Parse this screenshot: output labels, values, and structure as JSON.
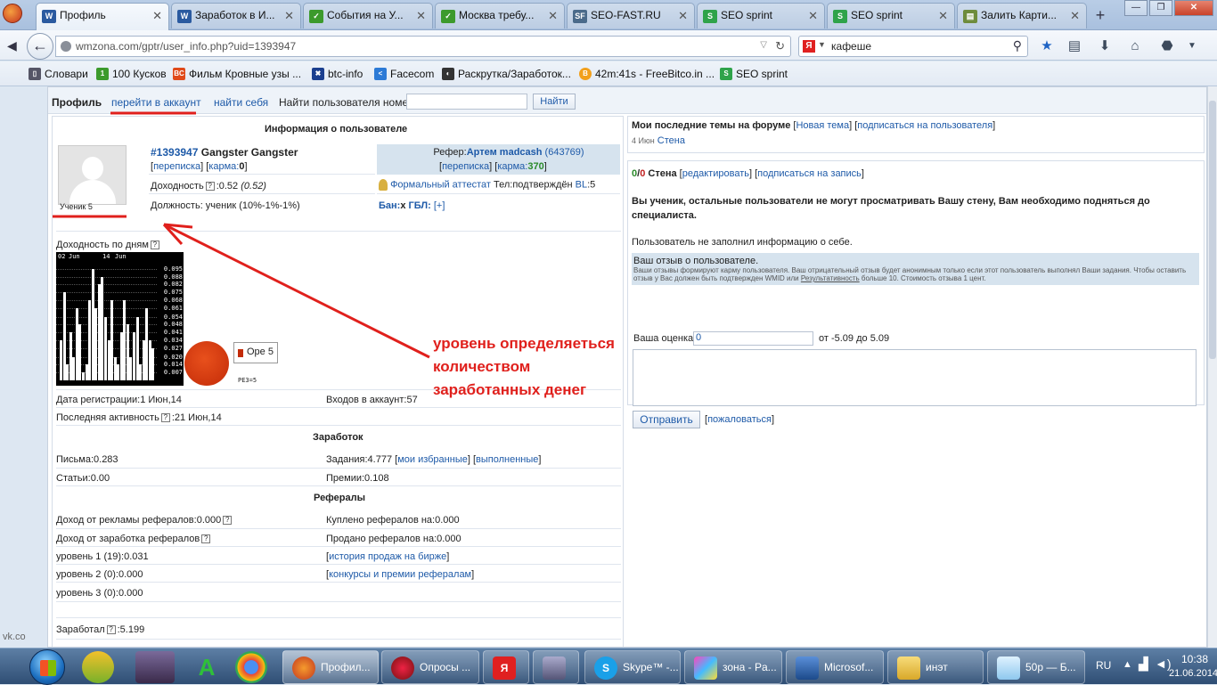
{
  "browser": {
    "tabs": [
      {
        "label": "Профиль",
        "icon": "wmzona-icon",
        "active": true
      },
      {
        "label": "Заработок в И...",
        "icon": "wmzona-icon"
      },
      {
        "label": "События на У...",
        "icon": "green-bookmark-icon"
      },
      {
        "label": "Москва требу...",
        "icon": "green-bookmark-icon"
      },
      {
        "label": "SEO-FAST.RU",
        "icon": "seofast-icon"
      },
      {
        "label": "SEO sprint",
        "icon": "seosprint-icon"
      },
      {
        "label": "SEO sprint",
        "icon": "seosprint-icon"
      },
      {
        "label": "Залить Карти...",
        "icon": "image-icon"
      }
    ],
    "url": "wmzona.com/gptr/user_info.php?uid=1393947",
    "search_value": "кафеше",
    "bookmarks": [
      {
        "label": "Словари",
        "icon": "dictionary-icon"
      },
      {
        "label": "100 Кусков",
        "icon": "green-bookmark-icon"
      },
      {
        "label": "Фильм Кровные узы ...",
        "icon": "bc-icon"
      },
      {
        "label": "btc-info",
        "icon": "btc-icon"
      },
      {
        "label": "Facecom",
        "icon": "facecom-icon"
      },
      {
        "label": "Раскрутка/Заработок...",
        "icon": "pacman-icon"
      },
      {
        "label": "42m:41s - FreeBitco.in ...",
        "icon": "bitcoin-icon"
      },
      {
        "label": "SEO sprint",
        "icon": "seosprint-icon"
      }
    ]
  },
  "site_menu": {
    "profile": "Профиль",
    "go_to_account": "перейти в аккаунт",
    "find_self": "найти себя",
    "find_user_label": "Найти пользователя номер",
    "find_button": "Найти"
  },
  "user_info": {
    "section_title": "Информация о пользователе",
    "user_id": "#1393947",
    "user_name": "Gangster Gangster",
    "correspondence": "переписка",
    "karma_label": "карма:",
    "karma_value": "0",
    "profitability_label": "Доходность",
    "profitability_value": ":0.52",
    "profitability_paren": "(0.52)",
    "position": "Должность: ученик (10%-1%-1%)",
    "avatar_caption": "Ученик 5",
    "referrer_label": "Рефер:",
    "referrer_name": "Артем madcash",
    "referrer_id": "(643769)",
    "referrer_correspondence": "переписка",
    "referrer_karma_label": "карма:",
    "referrer_karma_value": "370",
    "certificate": "Формальный аттестат",
    "phone": "Тел:подтверждён",
    "bl_label": "BL",
    "bl_value": ":5",
    "ban_label": "Бан:",
    "ban_value": "х",
    "gbl_label": "ГБЛ:",
    "gbl_value": "[+]",
    "daily_profit_label": "Доходность по дням",
    "pie_legend": "Ope 5",
    "pie_caption": "PE3=5",
    "reg_date": "Дата регистрации:1 Июн,14",
    "logins": "Входов в аккаунт:57",
    "last_activity_label": "Последняя активность",
    "last_activity_value": ":21 Июн,14"
  },
  "earnings": {
    "title": "Заработок",
    "letters": "Письма:0.283",
    "tasks": "Задания:4.777",
    "my_favorites": "мои избранные",
    "completed": "выполненные",
    "articles": "Статьи:0.00",
    "bonuses": "Премии:0.108"
  },
  "referrals": {
    "title": "Рефералы",
    "ads_income": "Доход от рекламы рефералов:0.000",
    "bought": "Куплено рефералов на:0.000",
    "earn_income": "Доход от заработка рефералов",
    "sold": "Продано рефералов на:0.000",
    "level1": "уровень 1 (19):0.031",
    "sales_history": "история продаж на бирже",
    "level2": "уровень 2 (0):0.000",
    "contests": "конкурсы и премии рефералам",
    "level3": "уровень 3 (0):0.000",
    "earned_label": "Заработал",
    "earned_value": ":5.199"
  },
  "forum": {
    "title": "Мои последние темы на форуме",
    "new_topic": "Новая тема",
    "subscribe_user": "подписаться на пользователя",
    "date": "4 Июн",
    "wall_link": "Стена"
  },
  "wall": {
    "count_a": "0",
    "count_sep": "/",
    "count_b": "0",
    "title": "Стена",
    "edit": "редактировать",
    "subscribe_post": "подписаться на запись",
    "notice": "Вы ученик, остальные пользователи не могут просматривать Вашу стену, Вам необходимо подняться до специалиста.",
    "no_info": "Пользователь не заполнил информацию о себе."
  },
  "review": {
    "title": "Ваш отзыв о пользователе.",
    "note_part1": "Ваши отзывы формируют карму пользователя. Ваш отрицательный отзыв будет анонимным только если этот пользователь выполнял Ваши задания. Чтобы оставить отзыв у Вас должен быть подтвержден WMID или ",
    "note_link": "Результативность",
    "note_part2": " больше 10. Стоимость отзыва 1 цент.",
    "rating_label": "Ваша оценка",
    "rating_value": "0",
    "range": "от -5.09 до 5.09",
    "send_button": "Отправить",
    "complain": "пожаловаться"
  },
  "annotation": {
    "line1": "уровень определяеться",
    "line2": "количеством",
    "line3": "заработанных денег",
    "color": "#e0201c"
  },
  "chart_data": {
    "type": "bar",
    "x_ticks": [
      "02",
      "Jun",
      "14",
      "Jun"
    ],
    "y_ticks": [
      "0.095",
      "0.088",
      "0.082",
      "0.075",
      "0.068",
      "0.061",
      "0.054",
      "0.048",
      "0.041",
      "0.034",
      "0.027",
      "0.020",
      "0.014",
      "0.007"
    ],
    "ylim": [
      0,
      0.1
    ],
    "values": [
      0.034,
      0.075,
      0.014,
      0.041,
      0.02,
      0.061,
      0.048,
      0.007,
      0.014,
      0.068,
      0.095,
      0.061,
      0.082,
      0.088,
      0.054,
      0.034,
      0.068,
      0.02,
      0.014,
      0.041,
      0.068,
      0.048,
      0.02,
      0.041,
      0.054,
      0.014,
      0.034,
      0.061,
      0.034,
      0.027
    ]
  },
  "taskbar": {
    "apps": [
      {
        "label": "Профил...",
        "icon": "firefox-icon",
        "active": true
      },
      {
        "label": "Опросы ...",
        "icon": "opera-like-icon"
      },
      {
        "label": "",
        "icon": "yandex-icon"
      },
      {
        "label": "",
        "icon": "sound-icon"
      },
      {
        "label": "Skype™ -...",
        "icon": "skype-icon"
      },
      {
        "label": "зона - Pa...",
        "icon": "paint-icon"
      },
      {
        "label": "Microsof...",
        "icon": "network-icon"
      },
      {
        "label": "инэт",
        "icon": "folder-icon"
      },
      {
        "label": "50р — Б...",
        "icon": "notepad-icon"
      }
    ],
    "language": "RU",
    "time": "10:38",
    "date": "21.06.2014"
  },
  "sidebar_hint": "vk.co"
}
